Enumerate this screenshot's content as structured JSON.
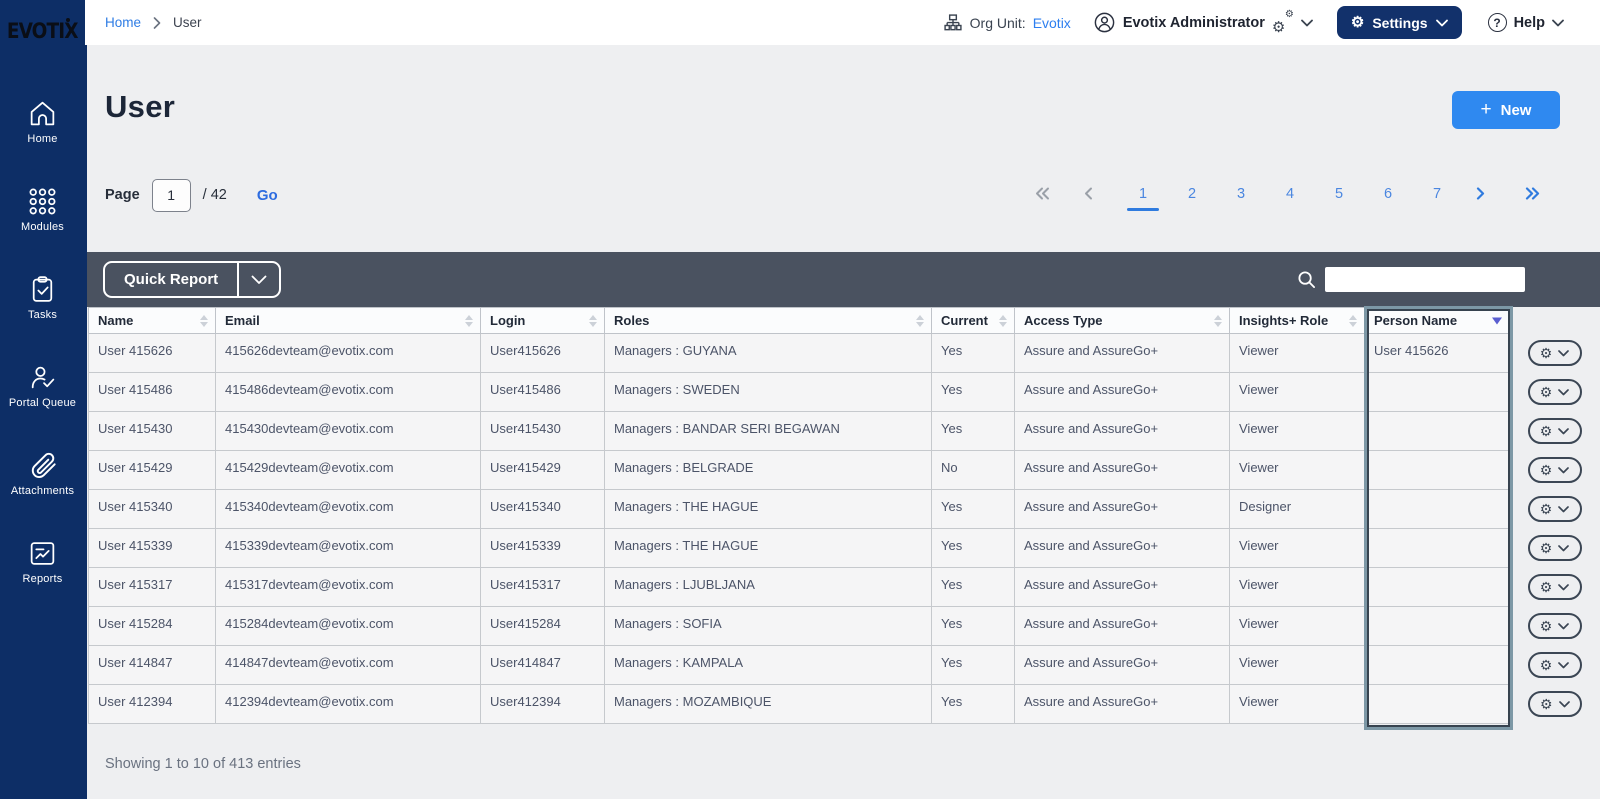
{
  "brand": {
    "logo": "EVOTIX"
  },
  "topbar": {
    "breadcrumb": {
      "home": "Home",
      "current": "User"
    },
    "org_unit_label": "Org Unit:",
    "org_unit_value": "Evotix",
    "admin_name": "Evotix Administrator",
    "settings_label": "Settings",
    "help_label": "Help"
  },
  "sidebar": {
    "items": [
      {
        "label": "Home"
      },
      {
        "label": "Modules"
      },
      {
        "label": "Tasks"
      },
      {
        "label": "Portal Queue"
      },
      {
        "label": "Attachments"
      },
      {
        "label": "Reports"
      }
    ]
  },
  "page": {
    "title": "User",
    "new_button": "New",
    "new_plus": "+",
    "page_label": "Page",
    "page_value": "1",
    "page_total": "/ 42",
    "go_label": "Go",
    "pagination": {
      "pages": [
        "1",
        "2",
        "3",
        "4",
        "5",
        "6",
        "7"
      ],
      "active": "1"
    }
  },
  "toolbar": {
    "quick_report": "Quick Report",
    "search_value": ""
  },
  "table": {
    "columns": [
      "Name",
      "Email",
      "Login",
      "Roles",
      "Current",
      "Access Type",
      "Insights+ Role",
      "Person Name"
    ],
    "sorted_column": "Person Name",
    "rows": [
      [
        "User 415626",
        "415626devteam@evotix.com",
        "User415626",
        "Managers : GUYANA",
        "Yes",
        "Assure and AssureGo+",
        "Viewer",
        "User 415626"
      ],
      [
        "User 415486",
        "415486devteam@evotix.com",
        "User415486",
        "Managers : SWEDEN",
        "Yes",
        "Assure and AssureGo+",
        "Viewer",
        ""
      ],
      [
        "User 415430",
        "415430devteam@evotix.com",
        "User415430",
        "Managers : BANDAR SERI BEGAWAN",
        "Yes",
        "Assure and AssureGo+",
        "Viewer",
        ""
      ],
      [
        "User 415429",
        "415429devteam@evotix.com",
        "User415429",
        "Managers : BELGRADE",
        "No",
        "Assure and AssureGo+",
        "Viewer",
        ""
      ],
      [
        "User 415340",
        "415340devteam@evotix.com",
        "User415340",
        "Managers : THE HAGUE",
        "Yes",
        "Assure and AssureGo+",
        "Designer",
        ""
      ],
      [
        "User 415339",
        "415339devteam@evotix.com",
        "User415339",
        "Managers : THE HAGUE",
        "Yes",
        "Assure and AssureGo+",
        "Viewer",
        ""
      ],
      [
        "User 415317",
        "415317devteam@evotix.com",
        "User415317",
        "Managers : LJUBLJANA",
        "Yes",
        "Assure and AssureGo+",
        "Viewer",
        ""
      ],
      [
        "User 415284",
        "415284devteam@evotix.com",
        "User415284",
        "Managers : SOFIA",
        "Yes",
        "Assure and AssureGo+",
        "Viewer",
        ""
      ],
      [
        "User 414847",
        "414847devteam@evotix.com",
        "User414847",
        "Managers : KAMPALA",
        "Yes",
        "Assure and AssureGo+",
        "Viewer",
        ""
      ],
      [
        "User 412394",
        "412394devteam@evotix.com",
        "User412394",
        "Managers : MOZAMBIQUE",
        "Yes",
        "Assure and AssureGo+",
        "Viewer",
        ""
      ]
    ],
    "footer": "Showing 1 to 10 of 413 entries"
  },
  "colors": {
    "sidebar_navy": "#0d2e66",
    "accent_blue": "#2f89f0",
    "link_blue": "#2d7ff0",
    "toolbar_slate": "#4a5260",
    "sort_indicator": "#5a5ed0",
    "selected_column_border": "#7d98a6"
  }
}
